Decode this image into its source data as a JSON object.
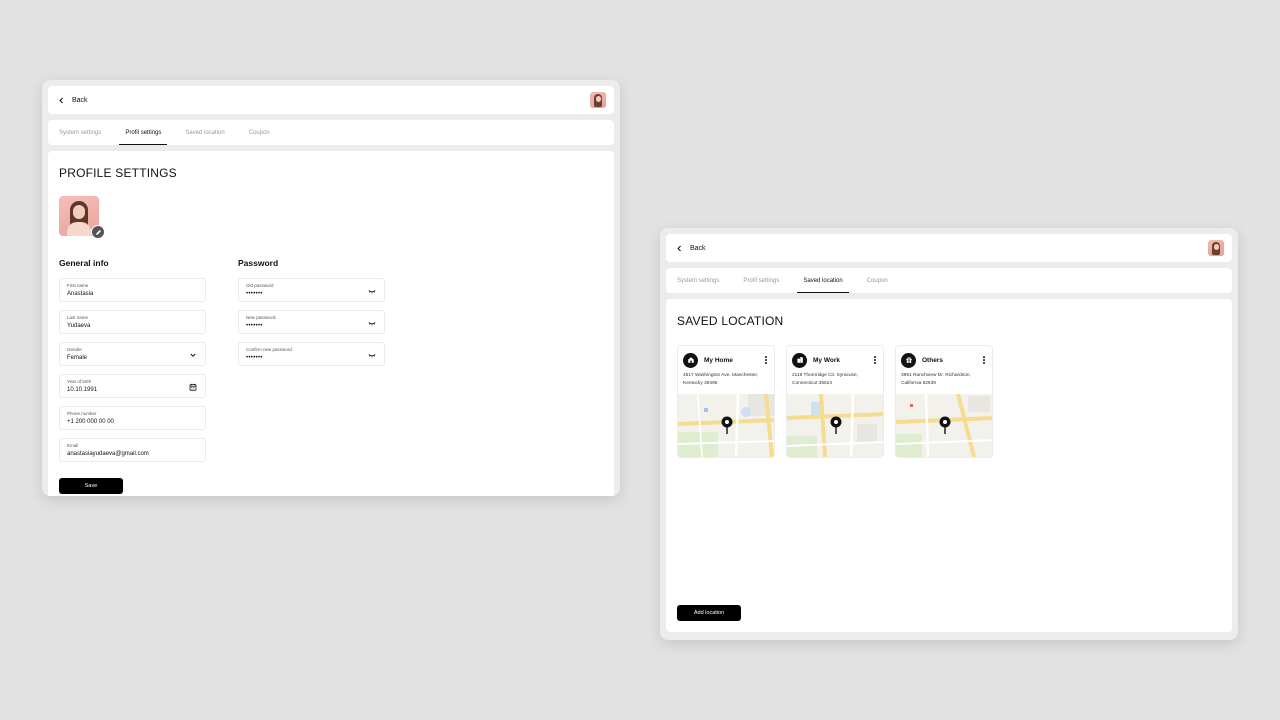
{
  "colors": {
    "background": "#e2e2e2",
    "accent": "#000000",
    "panel": "#ffffff"
  },
  "common": {
    "back_label": "Back",
    "tabs": [
      "System settings",
      "Profil settings",
      "Saved location",
      "Coupon"
    ]
  },
  "profile_window": {
    "active_tab": "Profil settings",
    "title": "PROFILE SETTINGS",
    "general_info": {
      "heading": "General info",
      "first_name": {
        "label": "First name",
        "value": "Anastasia"
      },
      "last_name": {
        "label": "Last name",
        "value": "Yudaeva"
      },
      "gender": {
        "label": "Gender",
        "value": "Female",
        "icon": "chevron-down-icon"
      },
      "birth": {
        "label": "Year of birth",
        "value": "10.10.1991",
        "icon": "calendar-icon"
      },
      "phone": {
        "label": "Phone number",
        "value": "+1 200 000 00 00"
      },
      "email": {
        "label": "Email",
        "value": "anastasiayudaeva@gmail.com"
      }
    },
    "password": {
      "heading": "Password",
      "old": {
        "label": "Old password",
        "value": "•••••••"
      },
      "new": {
        "label": "New password",
        "value": "•••••••"
      },
      "confirm": {
        "label": "Confirm new password",
        "value": "•••••••"
      }
    },
    "save_label": "Save"
  },
  "location_window": {
    "active_tab": "Saved location",
    "title": "SAVED LOCATION",
    "cards": [
      {
        "name": "My Home",
        "icon": "home-icon",
        "address": "4517 Washington Ave. Manchester, Kentucky 39495"
      },
      {
        "name": "My Work",
        "icon": "building-icon",
        "address": "2118 Thornridge Cir. Syracuse, Connecticut 35624"
      },
      {
        "name": "Others",
        "icon": "gift-icon",
        "address": "3891 Ranchview Dr. Richardson, California 62639"
      }
    ],
    "add_label": "Add location"
  }
}
